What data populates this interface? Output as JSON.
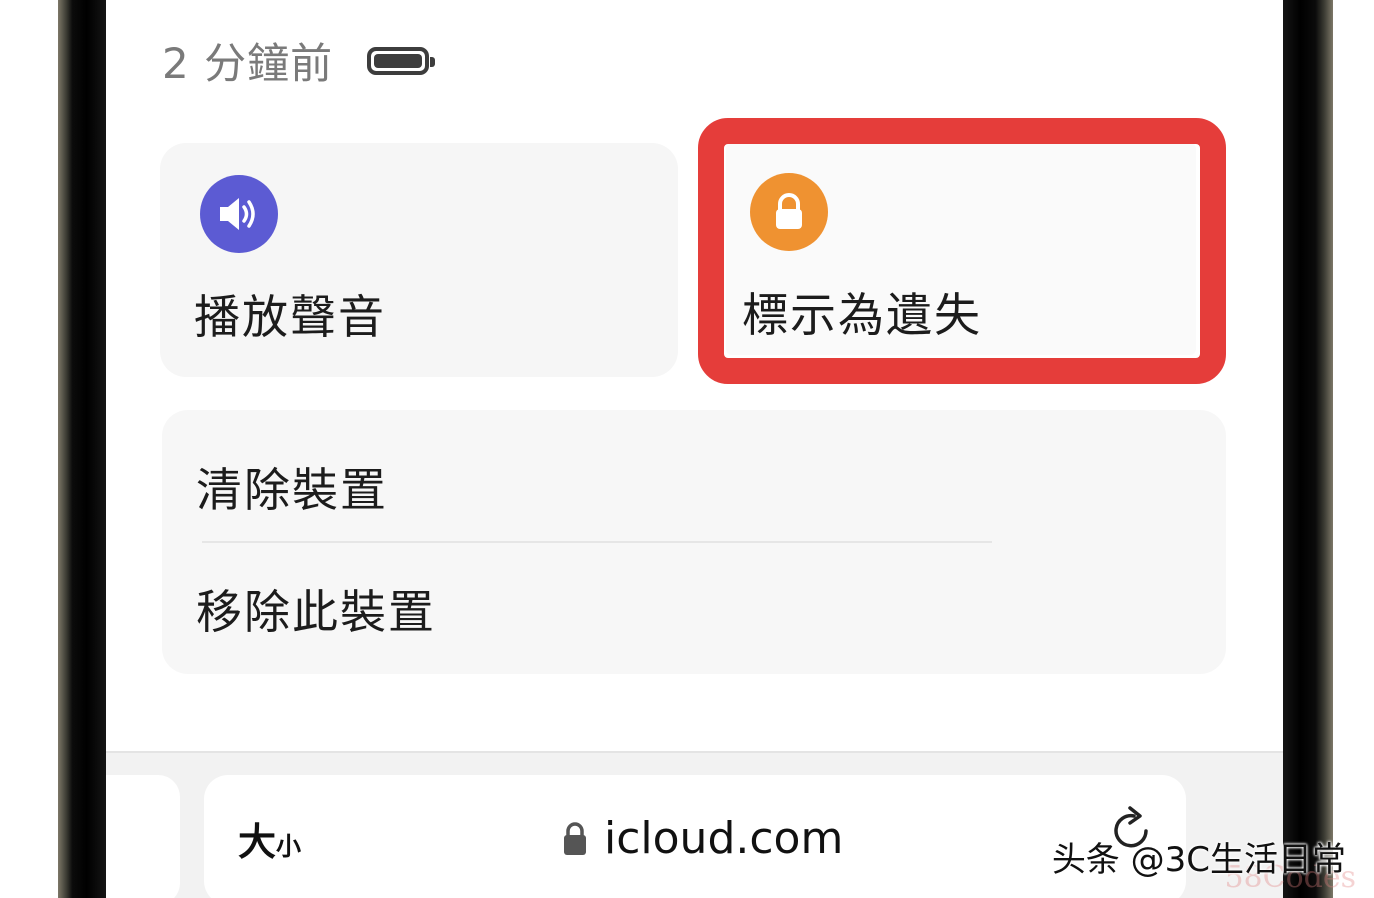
{
  "status": {
    "timestamp": "2 分鐘前",
    "battery_icon": "battery-full-icon"
  },
  "actions": {
    "play_sound": {
      "label": "播放聲音",
      "icon": "speaker-icon",
      "color": "#5c5bd3"
    },
    "mark_as_lost": {
      "label": "標示為遺失",
      "icon": "lock-icon",
      "color": "#ef9231",
      "highlight_color": "#e53d3a"
    }
  },
  "list": {
    "erase_device": "清除裝置",
    "remove_device": "移除此裝置"
  },
  "toolbar": {
    "text_size_large": "大",
    "text_size_small": "小",
    "url": "icloud.com",
    "reload_icon": "reload-icon"
  },
  "watermark": {
    "text": "头条 @3C生活日常",
    "faint_text": "58Codes"
  }
}
